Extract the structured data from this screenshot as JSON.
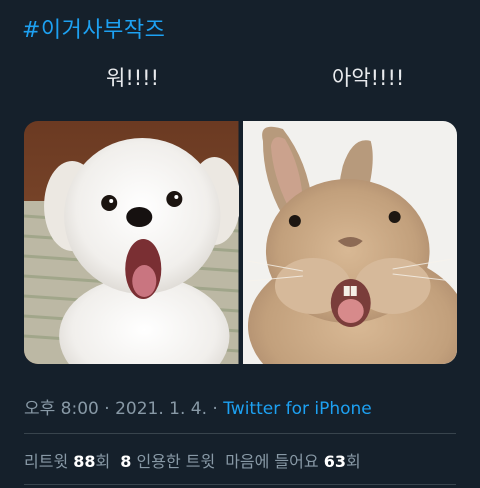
{
  "hashtag": "#이거사부작즈",
  "captions": {
    "left": "워!!!!",
    "right": "아악!!!!"
  },
  "media": {
    "left_image": "white puppy with open mouth",
    "right_image": "rabbit with open mouth"
  },
  "meta": {
    "time": "오후 8:00",
    "separator1": " · ",
    "date": "2021. 1. 4.",
    "separator2": " · ",
    "source": "Twitter for iPhone"
  },
  "stats": {
    "retweets_label": "리트윗",
    "retweets_count": "88",
    "retweets_suffix": "회",
    "quotes_count": "8",
    "quotes_label": "인용한 트윗",
    "likes_label": "마음에 들어요",
    "likes_count": "63",
    "likes_suffix": "회"
  },
  "colors": {
    "background": "#15202b",
    "link": "#1da1f2",
    "secondary_text": "#8899a6"
  }
}
